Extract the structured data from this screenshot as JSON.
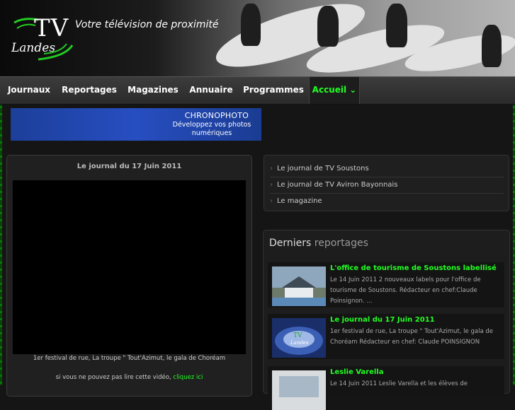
{
  "header": {
    "logo_tv": "TV",
    "logo_landes": "Landes",
    "tagline": "Votre télévision de proximité"
  },
  "nav": {
    "items": [
      {
        "label": "Journaux"
      },
      {
        "label": "Reportages"
      },
      {
        "label": "Magazines"
      },
      {
        "label": "Annuaire"
      },
      {
        "label": "Programmes"
      },
      {
        "label": "Accueil ⌄"
      }
    ],
    "active_color": "#22ff22"
  },
  "ad": {
    "title": "CHRONOPHOTO",
    "line1": "Développez vos photos",
    "line2": "numériques"
  },
  "video_panel": {
    "title": "Le journal du 17 Juin 2011",
    "caption": "1er festival de rue, La troupe \" Tout'Azimut, le gala de Choréam",
    "fallback_text": "si vous ne pouvez pas lire cette vidéo,",
    "fallback_link": "cliquez ici"
  },
  "links": [
    {
      "label": "Le journal de TV Soustons"
    },
    {
      "label": "Le journal de TV Aviron Bayonnais"
    },
    {
      "label": "Le magazine"
    }
  ],
  "reportages": {
    "heading_a": "Derniers",
    "heading_b": "reportages",
    "items": [
      {
        "title": "L'office de tourisme de Soustons labellisé",
        "text": "Le 14 Juin 2011 2 nouveaux labels pour l'office de tourisme de Soustons. Rédacteur en chef:Claude Poinsignon. ..."
      },
      {
        "title": "Le journal du 17 Juin 2011",
        "text": "1er festival de rue, La troupe \" Tout'Azimut, le gala de Choréam Rédacteur en chef: Claude POINSIGNON"
      },
      {
        "title": "Leslie Varella",
        "text": "Le 14 Juin 2011 Leslie Varella et les élèves de"
      }
    ]
  },
  "colors": {
    "accent_green": "#22ff22",
    "ad_blue": "#274ec1"
  }
}
